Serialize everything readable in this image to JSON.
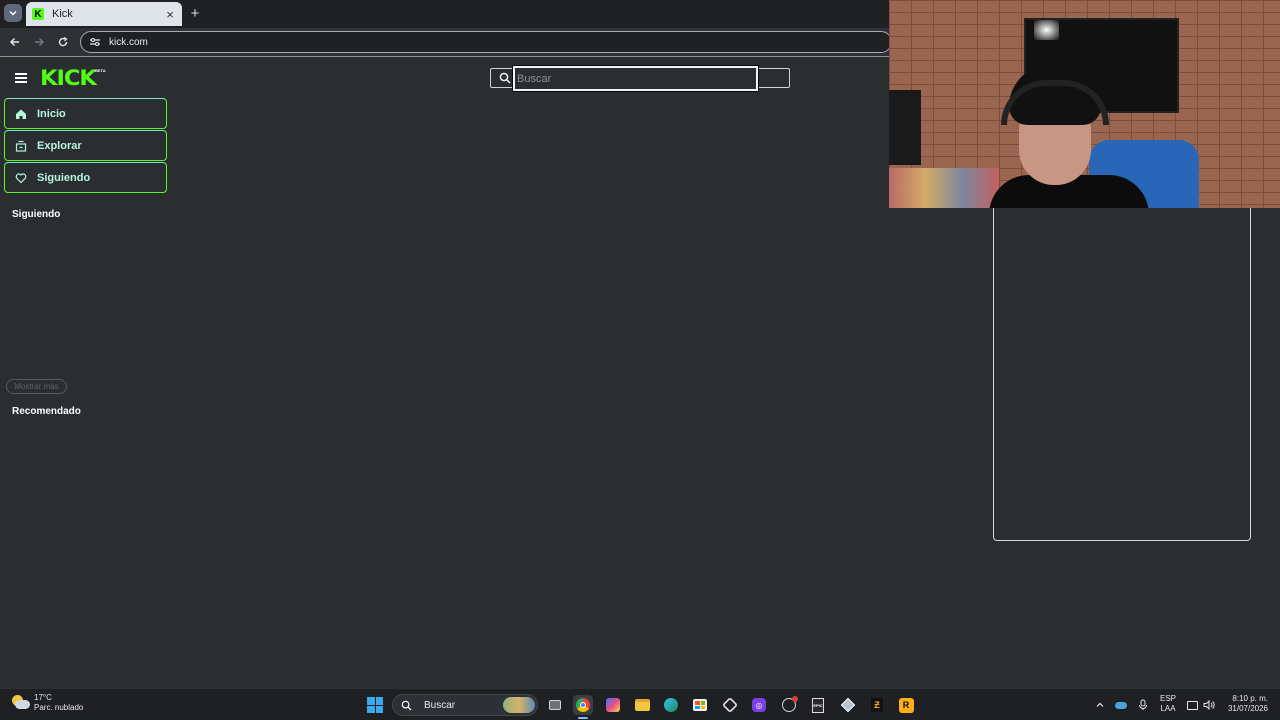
{
  "browser": {
    "tab_title": "Kick",
    "favicon_letter": "K",
    "url": "kick.com"
  },
  "header": {
    "logo": "KICK",
    "beta": "BETA",
    "search_placeholder": "Buscar"
  },
  "sidebar": {
    "nav": [
      {
        "label": "Inicio",
        "icon": "home-icon"
      },
      {
        "label": "Explorar",
        "icon": "explore-icon"
      },
      {
        "label": "Siguiendo",
        "icon": "heart-icon"
      }
    ],
    "following_title": "Siguiendo",
    "show_more": "Mostrar más",
    "recommended_title": "Recomendado"
  },
  "taskbar": {
    "weather_temp": "17°C",
    "weather_desc": "Parc. nublado",
    "search_label": "Buscar",
    "language_top": "ESP",
    "language_bottom": "LAA",
    "time": "8:10 p. m.",
    "date": "31/07/2026",
    "apps": [
      "task-view",
      "chrome",
      "photos",
      "file-explorer",
      "edge",
      "store",
      "office",
      "clipchamp",
      "steam",
      "epic-games",
      "3d-viewer",
      "rockstar-r",
      "rockstar-games"
    ]
  },
  "colors": {
    "accent": "#53fc18",
    "background": "#2b2e31"
  }
}
